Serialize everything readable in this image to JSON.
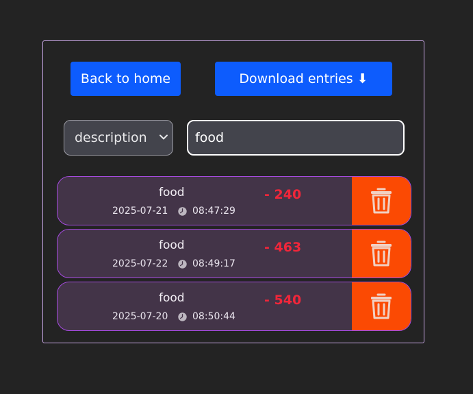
{
  "toolbar": {
    "back_label": "Back to home",
    "download_label": "Download entries ⬇"
  },
  "filter": {
    "field_selected": "description",
    "query_value": "food"
  },
  "entries": [
    {
      "description": "food",
      "date": "2025-07-21",
      "time": "08:47:29",
      "amount": "- 240"
    },
    {
      "description": "food",
      "date": "2025-07-22",
      "time": "08:49:17",
      "amount": "- 463"
    },
    {
      "description": "food",
      "date": "2025-07-20",
      "time": "08:50:44",
      "amount": "- 540"
    }
  ],
  "icons": {
    "delete": "trash-icon",
    "time": "clock-icon",
    "select": "chevron-down-icon"
  },
  "colors": {
    "background": "#232323",
    "panel_border": "#c9a8e6",
    "primary_button": "#0d5cfd",
    "entry_background": "#433448",
    "entry_border": "#a64be0",
    "amount_text": "#f0263a",
    "delete_button": "#fb4a03"
  }
}
